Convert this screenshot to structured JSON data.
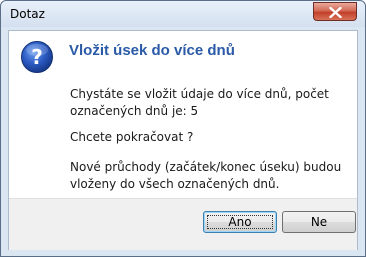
{
  "window": {
    "title": "Dotaz"
  },
  "dialog": {
    "icon": "question-icon",
    "heading": "Vložit úsek do více dnů",
    "message_line1": "Chystáte se vložit údaje do více dnů, počet",
    "message_line2": "označených dnů je: 5",
    "question": "Chcete pokračovat ?",
    "note_line1": "Nové průchody (začátek/konec úseku) budou",
    "note_line2": "vloženy do všech označených dnů."
  },
  "buttons": {
    "yes_label": "Ano",
    "no_label": "Ne"
  },
  "colors": {
    "heading": "#2a5aa7",
    "close_button": "#c2402a",
    "icon_fill": "#2c5cc4"
  }
}
